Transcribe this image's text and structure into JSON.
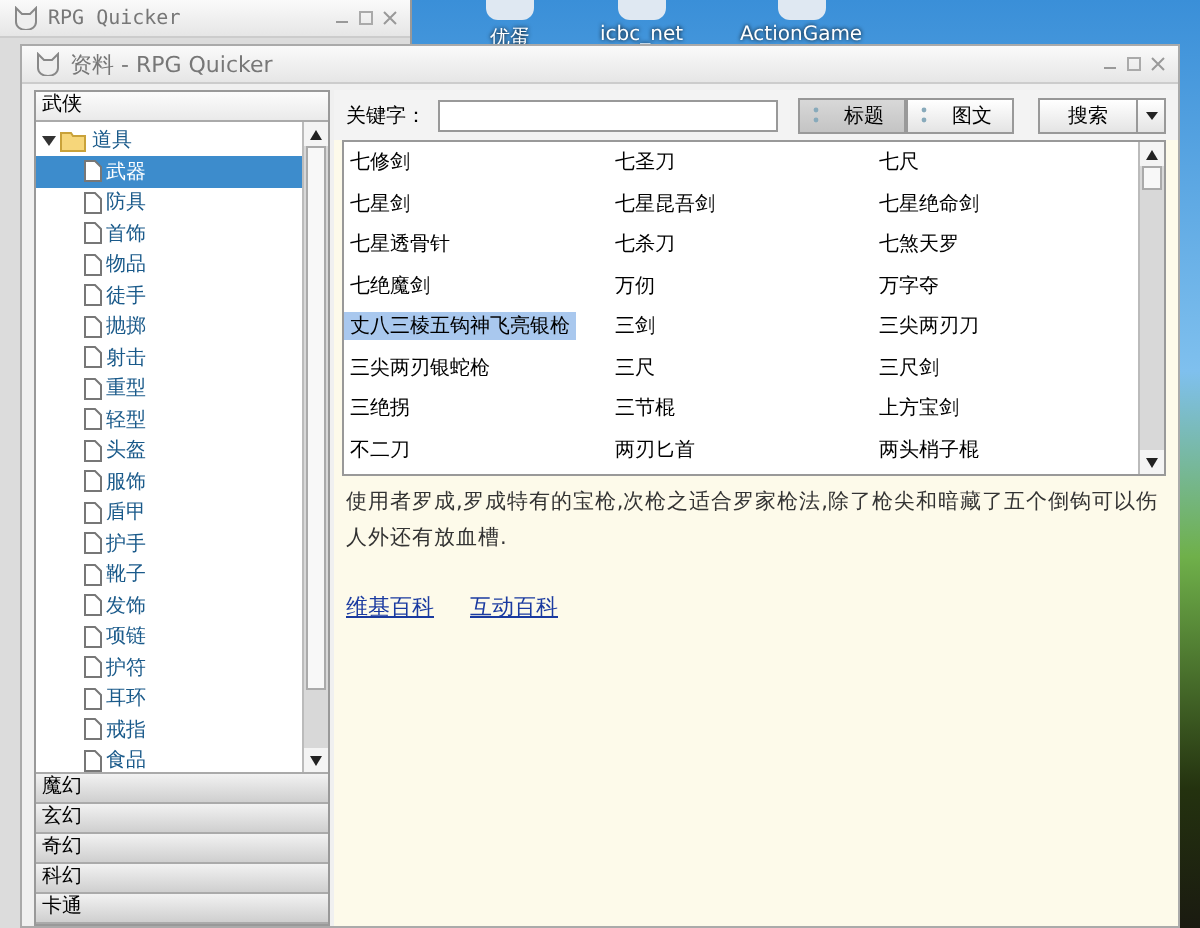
{
  "desktop": {
    "icons": [
      {
        "label": "优蛋"
      },
      {
        "label": "icbc_net"
      },
      {
        "label": "ActionGame"
      }
    ]
  },
  "back_window": {
    "title": "RPG Quicker"
  },
  "window": {
    "title": "资料 - RPG Quicker",
    "sidebar": {
      "sections": [
        {
          "label": "武侠",
          "expanded": true,
          "tree": [
            {
              "label": "道具",
              "expanded": true,
              "children": [
                {
                  "label": "武器",
                  "selected": true
                },
                {
                  "label": "防具",
                  "selected": false
                },
                {
                  "label": "首饰",
                  "selected": false
                },
                {
                  "label": "物品",
                  "selected": false
                },
                {
                  "label": "徒手",
                  "selected": false
                },
                {
                  "label": "抛掷",
                  "selected": false
                },
                {
                  "label": "射击",
                  "selected": false
                },
                {
                  "label": "重型",
                  "selected": false
                },
                {
                  "label": "轻型",
                  "selected": false
                },
                {
                  "label": "头盔",
                  "selected": false
                },
                {
                  "label": "服饰",
                  "selected": false
                },
                {
                  "label": "盾甲",
                  "selected": false
                },
                {
                  "label": "护手",
                  "selected": false
                },
                {
                  "label": "靴子",
                  "selected": false
                },
                {
                  "label": "发饰",
                  "selected": false
                },
                {
                  "label": "项链",
                  "selected": false
                },
                {
                  "label": "护符",
                  "selected": false
                },
                {
                  "label": "耳环",
                  "selected": false
                },
                {
                  "label": "戒指",
                  "selected": false
                },
                {
                  "label": "食品",
                  "selected": false
                }
              ]
            }
          ]
        },
        {
          "label": "魔幻",
          "expanded": false
        },
        {
          "label": "玄幻",
          "expanded": false
        },
        {
          "label": "奇幻",
          "expanded": false
        },
        {
          "label": "科幻",
          "expanded": false
        },
        {
          "label": "卡通",
          "expanded": false
        }
      ]
    },
    "search": {
      "label": "关键字：",
      "view_modes": [
        {
          "label": "标题",
          "selected": true
        },
        {
          "label": "图文",
          "selected": false
        }
      ],
      "button": "搜索"
    },
    "table": {
      "rows": [
        [
          {
            "text": "七修剑",
            "selected": false
          },
          {
            "text": "七圣刀",
            "selected": false
          },
          {
            "text": "七尺",
            "selected": false
          }
        ],
        [
          {
            "text": "七星剑",
            "selected": false
          },
          {
            "text": "七星昆吾剑",
            "selected": false
          },
          {
            "text": "七星绝命剑",
            "selected": false
          }
        ],
        [
          {
            "text": "七星透骨针",
            "selected": false
          },
          {
            "text": "七杀刀",
            "selected": false
          },
          {
            "text": "七煞天罗",
            "selected": false
          }
        ],
        [
          {
            "text": "七绝魔剑",
            "selected": false
          },
          {
            "text": "万仞",
            "selected": false
          },
          {
            "text": "万字夺",
            "selected": false
          }
        ],
        [
          {
            "text": "丈八三棱五钩神飞亮银枪",
            "selected": true
          },
          {
            "text": "三剑",
            "selected": false
          },
          {
            "text": "三尖两刃刀",
            "selected": false
          }
        ],
        [
          {
            "text": "三尖两刃银蛇枪",
            "selected": false
          },
          {
            "text": "三尺",
            "selected": false
          },
          {
            "text": "三尺剑",
            "selected": false
          }
        ],
        [
          {
            "text": "三绝拐",
            "selected": false
          },
          {
            "text": "三节棍",
            "selected": false
          },
          {
            "text": "上方宝剑",
            "selected": false
          }
        ],
        [
          {
            "text": "不二刀",
            "selected": false
          },
          {
            "text": "两刃匕首",
            "selected": false
          },
          {
            "text": "两头梢子棍",
            "selected": false
          }
        ]
      ]
    },
    "description": "使用者罗成,罗成特有的宝枪,次枪之适合罗家枪法,除了枪尖和暗藏了五个倒钩可以伤人外还有放血槽.",
    "links": [
      "维基百科",
      "互动百科"
    ]
  }
}
